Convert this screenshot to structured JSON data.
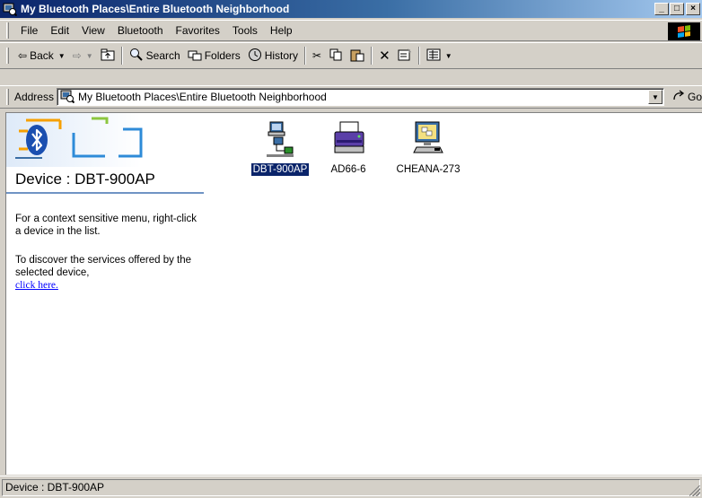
{
  "window": {
    "title": "My Bluetooth Places\\Entire Bluetooth Neighborhood",
    "buttons": {
      "minimize": "_",
      "maximize": "□",
      "close": "×"
    }
  },
  "menubar": {
    "items": [
      "File",
      "Edit",
      "View",
      "Bluetooth",
      "Favorites",
      "Tools",
      "Help"
    ]
  },
  "toolbar": {
    "back_label": "Back",
    "search_label": "Search",
    "folders_label": "Folders",
    "history_label": "History"
  },
  "address": {
    "label": "Address",
    "value": "My Bluetooth Places\\Entire Bluetooth Neighborhood",
    "go_label": "Go"
  },
  "leftpane": {
    "device_title": "Device : DBT-900AP",
    "help_line1": "For a context sensitive menu, right-click a device in the list.",
    "help_line2": "To discover the services offered by the selected device,",
    "link_text": "click here."
  },
  "devices": [
    {
      "label": "DBT-900AP",
      "icon": "network-access-point-icon",
      "selected": true
    },
    {
      "label": "AD66-6",
      "icon": "printer-icon",
      "selected": false
    },
    {
      "label": "CHEANA-273",
      "icon": "computer-icon",
      "selected": false
    }
  ],
  "status": {
    "text": "Device : DBT-900AP"
  },
  "colors": {
    "title_active": "#0a246a",
    "selection": "#0a246a",
    "link": "#0000ff",
    "face": "#d4d0c8"
  }
}
